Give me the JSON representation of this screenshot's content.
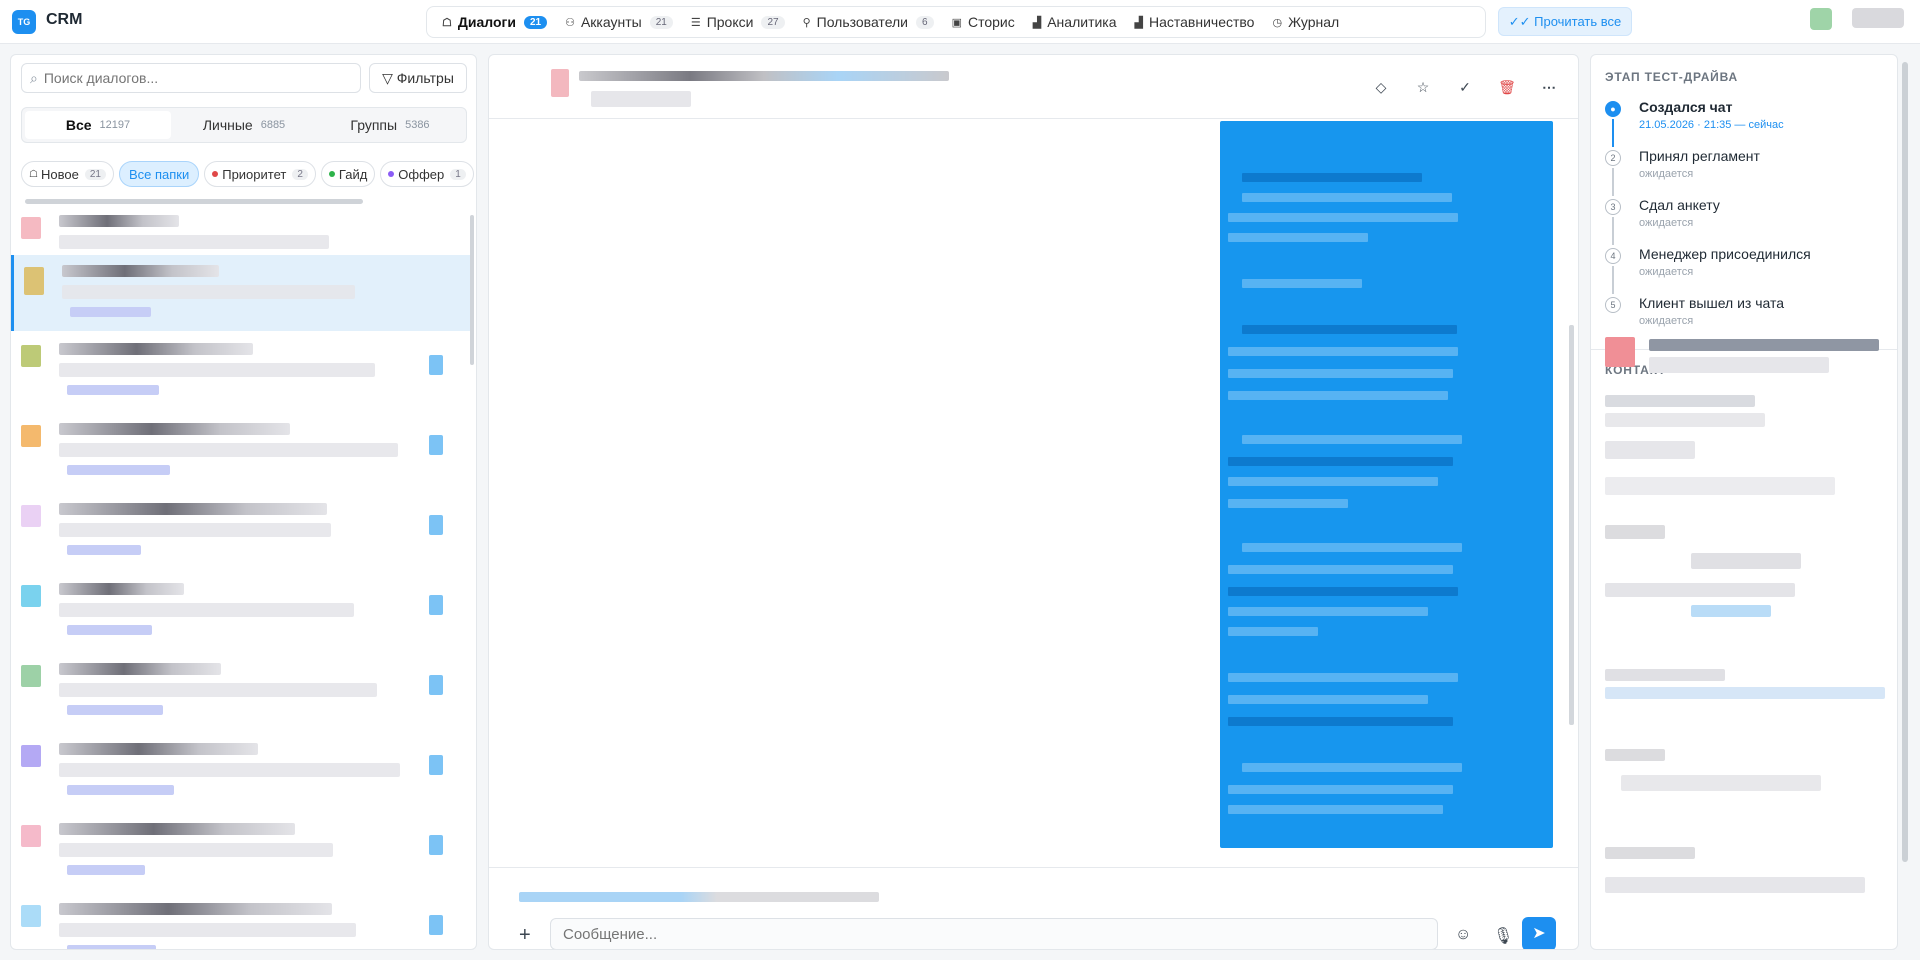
{
  "app": {
    "logo_text": "TG",
    "title": "CRM"
  },
  "nav": [
    {
      "label": "Диалоги",
      "count": "21",
      "icon": "chat-icon",
      "glyph": "☖",
      "active": true
    },
    {
      "label": "Аккаунты",
      "count": "21",
      "icon": "accounts-icon",
      "glyph": "⚇"
    },
    {
      "label": "Прокси",
      "count": "27",
      "icon": "proxy-icon",
      "glyph": "☰"
    },
    {
      "label": "Пользователи",
      "count": "6",
      "icon": "user-icon",
      "glyph": "⚲"
    },
    {
      "label": "Сторис",
      "count": "",
      "icon": "stories-icon",
      "glyph": "▣"
    },
    {
      "label": "Аналитика",
      "count": "",
      "icon": "analytics-icon",
      "glyph": "▟"
    },
    {
      "label": "Наставничество",
      "count": "",
      "icon": "mentoring-icon",
      "glyph": "▟"
    },
    {
      "label": "Журнал",
      "count": "",
      "icon": "clock-icon",
      "glyph": "◷"
    }
  ],
  "read_all": "✓✓ Прочитать все",
  "left": {
    "search_placeholder": "Поиск диалогов...",
    "filters_label": "Фильтры",
    "segments": [
      {
        "label": "Все",
        "count": "12197",
        "active": true
      },
      {
        "label": "Личные",
        "count": "6885"
      },
      {
        "label": "Группы",
        "count": "5386"
      }
    ],
    "chips": [
      {
        "label": "Новое",
        "count": "21",
        "prefix": "☖",
        "dot": ""
      },
      {
        "label": "Все папки",
        "count": "",
        "prefix": "",
        "dot": "",
        "active": true
      },
      {
        "label": "Приоритет",
        "count": "2",
        "prefix": "",
        "dot": "#e04848"
      },
      {
        "label": "Гайд",
        "count": "",
        "prefix": "",
        "dot": "#2db34a"
      },
      {
        "label": "Оффер",
        "count": "1",
        "prefix": "",
        "dot": "#8b5cf6"
      }
    ]
  },
  "composer": {
    "placeholder": "Сообщение..."
  },
  "right": {
    "stage_title": "ЭТАП ТЕСТ-ДРАЙВА",
    "steps": [
      {
        "num": "",
        "label": "Создался чат",
        "sub": "21.05.2026 · 21:35 — сейчас",
        "current": true
      },
      {
        "num": "2",
        "label": "Принял регламент",
        "sub": "ожидается"
      },
      {
        "num": "3",
        "label": "Сдал анкету",
        "sub": "ожидается"
      },
      {
        "num": "4",
        "label": "Менеджер присоединился",
        "sub": "ожидается"
      },
      {
        "num": "5",
        "label": "Клиент вышел из чата",
        "sub": "ожидается"
      }
    ],
    "contact_title": "КОНТАКТ"
  },
  "colors": {
    "accent": "#1d8ff0",
    "bubble": "#1796ee",
    "selected_row": "#e2f0fb",
    "delete": "#e04848"
  }
}
